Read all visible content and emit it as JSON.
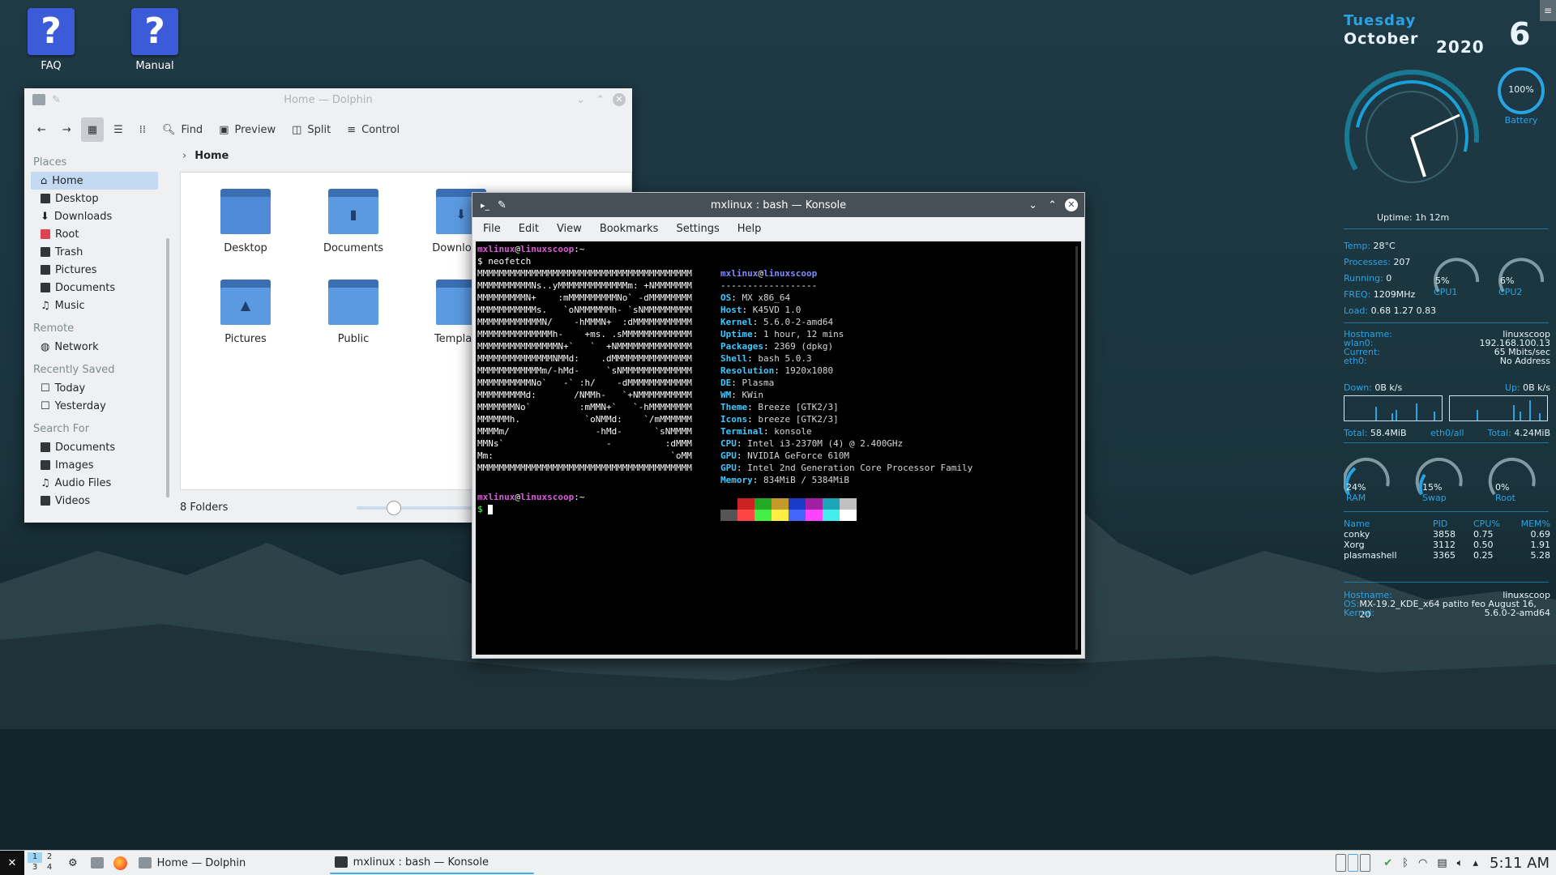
{
  "desktop": {
    "icons": [
      {
        "label": "FAQ",
        "glyph": "?"
      },
      {
        "label": "Manual",
        "glyph": "?"
      }
    ]
  },
  "dolphin": {
    "title": "Home — Dolphin",
    "toolbar": {
      "find": "Find",
      "preview": "Preview",
      "split": "Split",
      "control": "Control"
    },
    "places_header": "Places",
    "places": [
      "Home",
      "Desktop",
      "Downloads",
      "Root",
      "Trash",
      "Pictures",
      "Documents",
      "Music"
    ],
    "remote_header": "Remote",
    "remote": [
      "Network"
    ],
    "recent_header": "Recently Saved",
    "recent": [
      "Today",
      "Yesterday"
    ],
    "search_header": "Search For",
    "search": [
      "Documents",
      "Images",
      "Audio Files",
      "Videos"
    ],
    "breadcrumb": "Home",
    "folders": [
      "Desktop",
      "Documents",
      "Downloads",
      "Pictures",
      "Public",
      "Templates"
    ],
    "status": "8 Folders",
    "zoom": 0.25
  },
  "konsole": {
    "title": "mxlinux : bash — Konsole",
    "menu": [
      "File",
      "Edit",
      "View",
      "Bookmarks",
      "Settings",
      "Help"
    ],
    "prompt_user": "mxlinux",
    "prompt_at": "@",
    "prompt_host": "linuxscoop",
    "prompt_path": ":~",
    "command": "$ neofetch",
    "prompt_symbol": "$ ",
    "logo": "MMMMMMMMMMMMMMMMMMMMMMMMMMMMMMMMMMMMMMMM\nMMMMMMMMMMNs..yMMMMMMMMMMMMMm: +NMMMMMMM\nMMMMMMMMMN+    :mMMMMMMMMMNo` -dMMMMMMMM\nMMMMMMMMMMMs.   `oNMMMMMMh- `sNMMMMMMMMM\nMMMMMMMMMMMMN/    -hMMMN+  :dMMMMMMMMMMM\nMMMMMMMMMMMMMMh-    +ms. .sMMMMMMMMMMMMM\nMMMMMMMMMMMMMMMN+`   `  +NMMMMMMMMMMMMMM\nMMMMMMMMMMMMMMNMMd:    .dMMMMMMMMMMMMMMM\nMMMMMMMMMMMMm/-hMd-     `sNMMMMMMMMMMMMM\nMMMMMMMMMMNo`   -` :h/    -dMMMMMMMMMMMM\nMMMMMMMMMd:       /NMMh-   `+NMMMMMMMMMM\nMMMMMMMNo`         :mMMN+`   `-hMMMMMMMM\nMMMMMMh.            `oNMMd:    `/mMMMMMM\nMMMMm/                -hMd-      `sNMMMM\nMMNs`                   -          :dMMM\nMm:                                 `oMM\nMMMMMMMMMMMMMMMMMMMMMMMMMMMMMMMMMMMMMMMM",
    "info_user": "mxlinux",
    "info_host": "linuxscoop",
    "separator": "------------------",
    "info": [
      {
        "k": "OS",
        "v": "MX x86_64"
      },
      {
        "k": "Host",
        "v": "K45VD 1.0"
      },
      {
        "k": "Kernel",
        "v": "5.6.0-2-amd64"
      },
      {
        "k": "Uptime",
        "v": "1 hour, 12 mins"
      },
      {
        "k": "Packages",
        "v": "2369 (dpkg)"
      },
      {
        "k": "Shell",
        "v": "bash 5.0.3"
      },
      {
        "k": "Resolution",
        "v": "1920x1080"
      },
      {
        "k": "DE",
        "v": "Plasma"
      },
      {
        "k": "WM",
        "v": "KWin"
      },
      {
        "k": "Theme",
        "v": "Breeze [GTK2/3]"
      },
      {
        "k": "Icons",
        "v": "breeze [GTK2/3]"
      },
      {
        "k": "Terminal",
        "v": "konsole"
      },
      {
        "k": "CPU",
        "v": "Intel i3-2370M (4) @ 2.400GHz"
      },
      {
        "k": "GPU",
        "v": "NVIDIA GeForce 610M"
      },
      {
        "k": "GPU",
        "v": "Intel 2nd Generation Core Processor Family"
      },
      {
        "k": "Memory",
        "v": "834MiB / 5384MiB"
      }
    ],
    "palette_top": [
      "#000000",
      "#cc2222",
      "#22aa22",
      "#c49a2a",
      "#1a3ac8",
      "#a020a0",
      "#1aa6b6",
      "#c0c0c0"
    ],
    "palette_bottom": [
      "#555555",
      "#ff4444",
      "#44ee44",
      "#ffee44",
      "#4466ff",
      "#ff44ff",
      "#44eeee",
      "#ffffff"
    ]
  },
  "conky": {
    "day": "Tuesday",
    "month": "October",
    "year": "2020",
    "date": "6",
    "battery_pct": "100%",
    "battery_label": "Battery",
    "uptime": "Uptime: 1h 12m",
    "temp_label": "Temp:",
    "temp": "28°C",
    "proc_label": "Processes:",
    "proc": "207",
    "run_label": "Running:",
    "run": "0",
    "freq_label": "FREQ:",
    "freq": "1209MHz",
    "load_label": "Load:",
    "load": "0.68 1.27 0.83",
    "cpu1_pct": "5%",
    "cpu1_label": "CPU1",
    "cpu2_pct": "6%",
    "cpu2_label": "CPU2",
    "net": [
      {
        "k": "Hostname:",
        "v": "linuxscoop"
      },
      {
        "k": "wlan0:",
        "v": "192.168.100.13"
      },
      {
        "k": "Current:",
        "v": "65 Mbits/sec"
      },
      {
        "k": "eth0:",
        "v": "No Address"
      }
    ],
    "down_label": "Down:",
    "down": "0B  k/s",
    "up_label": "Up:",
    "up": "0B  k/s",
    "total_down_label": "Total:",
    "total_down": "58.4MiB",
    "mid_label": "eth0/all",
    "total_up_label": "Total:",
    "total_up": "4.24MiB",
    "rings": [
      {
        "pct": "24%",
        "label": "RAM"
      },
      {
        "pct": "15%",
        "label": "Swap"
      },
      {
        "pct": "0%",
        "label": "Root"
      }
    ],
    "proc_headers": [
      "Name",
      "PID",
      "CPU%",
      "MEM%"
    ],
    "procs": [
      {
        "name": "conky",
        "pid": "3858",
        "cpu": "0.75",
        "mem": "0.69"
      },
      {
        "name": "Xorg",
        "pid": "3112",
        "cpu": "0.50",
        "mem": "1.91"
      },
      {
        "name": "plasmashell",
        "pid": "3365",
        "cpu": "0.25",
        "mem": "5.28"
      }
    ],
    "sys": [
      {
        "k": "Hostname:",
        "v": "linuxscoop"
      },
      {
        "k": "OS:",
        "v": "MX-19.2_KDE_x64 patito feo August 16, 20"
      },
      {
        "k": "Kernel:",
        "v": "5.6.0-2-amd64"
      }
    ]
  },
  "taskbar": {
    "pager": [
      "1",
      "2",
      "3",
      "4"
    ],
    "tasks": [
      "Home — Dolphin",
      "mxlinux : bash — Konsole"
    ],
    "clock": "5:11 AM"
  },
  "colors": {
    "accent": "#3daee9",
    "conky_blue": "#29a3e4"
  }
}
